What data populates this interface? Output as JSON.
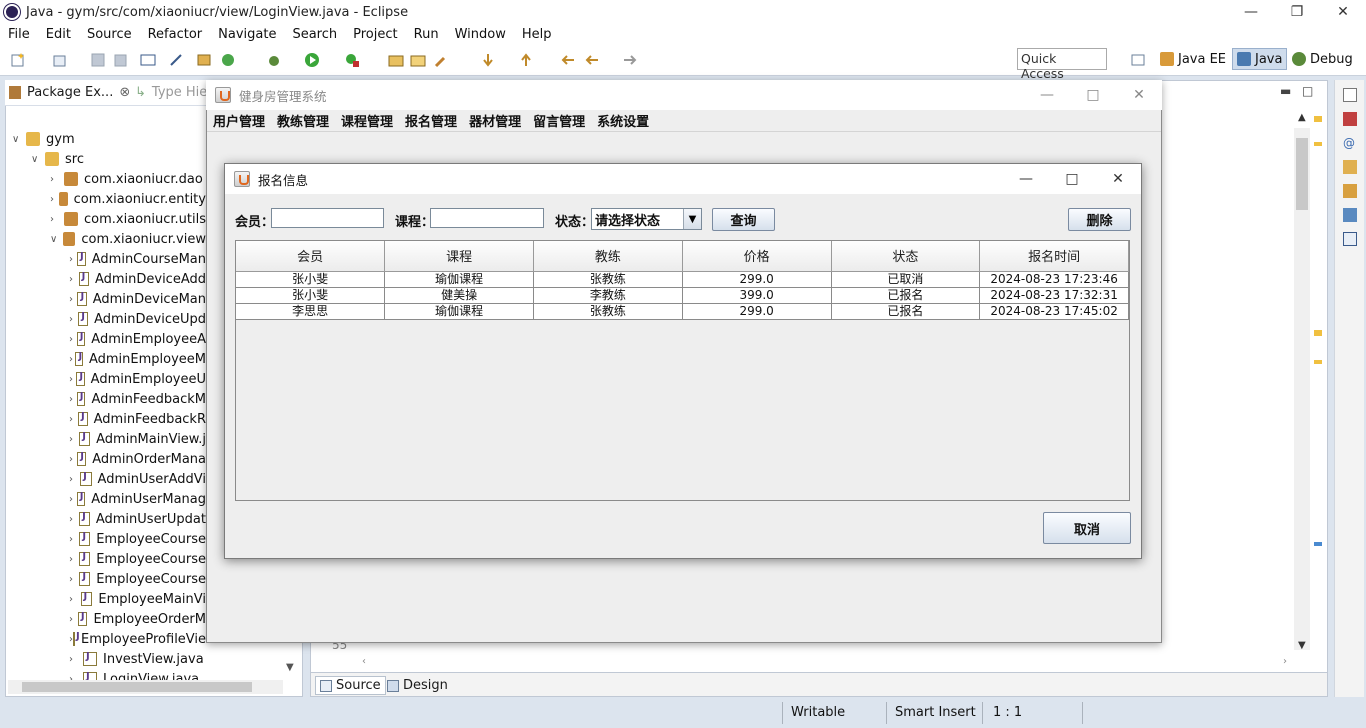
{
  "eclipse": {
    "title": "Java - gym/src/com/xiaoniucr/view/LoginView.java - Eclipse",
    "menu": [
      "File",
      "Edit",
      "Source",
      "Refactor",
      "Navigate",
      "Search",
      "Project",
      "Run",
      "Window",
      "Help"
    ],
    "quick_access": "Quick Access",
    "perspectives": [
      "Java EE",
      "Java",
      "Debug"
    ],
    "left_tabs": {
      "package_explorer": "Package Ex...",
      "type_hierarchy": "Type Hie"
    },
    "tree": [
      {
        "label": "gym",
        "kind": "project"
      },
      {
        "label": "src",
        "kind": "folder"
      },
      {
        "label": "com.xiaoniucr.dao",
        "kind": "package"
      },
      {
        "label": "com.xiaoniucr.entity",
        "kind": "package"
      },
      {
        "label": "com.xiaoniucr.utils",
        "kind": "package"
      },
      {
        "label": "com.xiaoniucr.view",
        "kind": "package"
      },
      {
        "label": "AdminCourseMan",
        "kind": "java"
      },
      {
        "label": "AdminDeviceAdd",
        "kind": "java"
      },
      {
        "label": "AdminDeviceMan",
        "kind": "java"
      },
      {
        "label": "AdminDeviceUpd",
        "kind": "java"
      },
      {
        "label": "AdminEmployeeA",
        "kind": "java"
      },
      {
        "label": "AdminEmployeeM",
        "kind": "java"
      },
      {
        "label": "AdminEmployeeU",
        "kind": "java"
      },
      {
        "label": "AdminFeedbackM",
        "kind": "java"
      },
      {
        "label": "AdminFeedbackR",
        "kind": "java"
      },
      {
        "label": "AdminMainView.j",
        "kind": "java"
      },
      {
        "label": "AdminOrderMana",
        "kind": "java"
      },
      {
        "label": "AdminUserAddVi",
        "kind": "java"
      },
      {
        "label": "AdminUserManag",
        "kind": "java"
      },
      {
        "label": "AdminUserUpdat",
        "kind": "java"
      },
      {
        "label": "EmployeeCourse",
        "kind": "java"
      },
      {
        "label": "EmployeeCourse",
        "kind": "java"
      },
      {
        "label": "EmployeeCourse",
        "kind": "java"
      },
      {
        "label": "EmployeeMainVi",
        "kind": "java"
      },
      {
        "label": "EmployeeOrderM",
        "kind": "java"
      },
      {
        "label": "EmployeeProfileView.java",
        "kind": "java"
      },
      {
        "label": "InvestView.java",
        "kind": "java"
      },
      {
        "label": "LoginView.java",
        "kind": "java"
      }
    ],
    "line_number": "55",
    "editor_tabs": [
      "Source",
      "Design"
    ],
    "status": {
      "writable": "Writable",
      "insert_mode": "Smart Insert",
      "position": "1 : 1"
    }
  },
  "main_frame": {
    "title": "健身房管理系统",
    "menu": [
      "用户管理",
      "教练管理",
      "课程管理",
      "报名管理",
      "器材管理",
      "留言管理",
      "系统设置"
    ]
  },
  "dialog": {
    "title": "报名信息",
    "member_label": "会员：",
    "member_value": "",
    "course_label": "课程：",
    "course_value": "",
    "status_label": "状态：",
    "status_selected": "请选择状态",
    "query_button": "查询",
    "delete_button": "删除",
    "cancel_button": "取消",
    "columns": [
      "会员",
      "课程",
      "教练",
      "价格",
      "状态",
      "报名时间"
    ],
    "rows": [
      [
        "张小斐",
        "瑜伽课程",
        "张教练",
        "299.0",
        "已取消",
        "2024-08-23 17:23:46"
      ],
      [
        "张小斐",
        "健美操",
        "李教练",
        "399.0",
        "已报名",
        "2024-08-23 17:32:31"
      ],
      [
        "李思思",
        "瑜伽课程",
        "张教练",
        "299.0",
        "已报名",
        "2024-08-23 17:45:02"
      ]
    ]
  }
}
